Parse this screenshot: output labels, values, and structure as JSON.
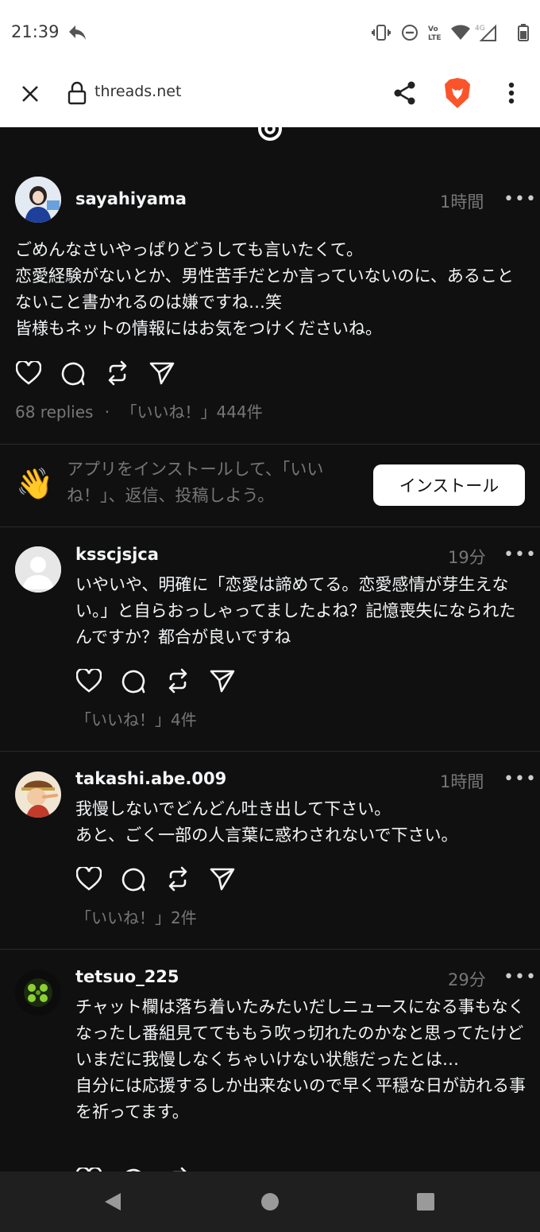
{
  "status_bar": {
    "time": "21:39",
    "icons": [
      "reply-arrow-icon",
      "vibrate-icon",
      "do-not-disturb-icon",
      "volte-icon",
      "wifi-icon",
      "signal-4g-icon",
      "battery-icon"
    ]
  },
  "browser": {
    "url": "threads.net",
    "icons": [
      "close-icon",
      "lock-icon",
      "share-icon",
      "brave-icon",
      "more-vert-icon"
    ]
  },
  "post": {
    "username": "sayahiyama",
    "time": "1時間",
    "more": "•••",
    "text": "ごめんなさいやっぱりどうしても言いたくて。\n恋愛経験がないとか、男性苦手だとか言っていないのに、あることないこと書かれるのは嫌ですね…笑\n皆様もネットの情報にはお気をつけくださいね。",
    "replies": "68 replies",
    "separator": "·",
    "likes": "「いいね！」444件"
  },
  "install_banner": {
    "emoji": "👋",
    "text": "アプリをインストールして、「いいね！」、返信、投稿しよう。",
    "button": "インストール"
  },
  "replies": [
    {
      "username": "ksscjsjca",
      "time": "19分",
      "more": "•••",
      "text": "いやいや、明確に「恋愛は諦めてる。恋愛感情が芽生えない。」と自らおっしゃってましたよね？記憶喪失になられたんですか？都合が良いですね",
      "likes": "「いいね！」4件"
    },
    {
      "username": "takashi.abe.009",
      "time": "1時間",
      "more": "•••",
      "text": "我慢しないでどんどん吐き出して下さい。\nあと、ごく一部の人言葉に惑わされないで下さい。",
      "likes": "「いいね！」2件"
    },
    {
      "username": "tetsuo_225",
      "time": "29分",
      "more": "•••",
      "text": "チャット欄は落ち着いたみたいだしニュースになる事もなくなったし番組見ててももう吹っ切れたのかなと思ってたけどいまだに我慢しなくちゃいけない状態だったとは…\n自分には応援するしか出来ないので早く平穏な日が訪れる事を祈ってます。"
    }
  ],
  "colors": {
    "background": "#101010",
    "text_primary": "#f3f5f7",
    "text_secondary": "#777777",
    "brave_orange": "#fb542b"
  }
}
